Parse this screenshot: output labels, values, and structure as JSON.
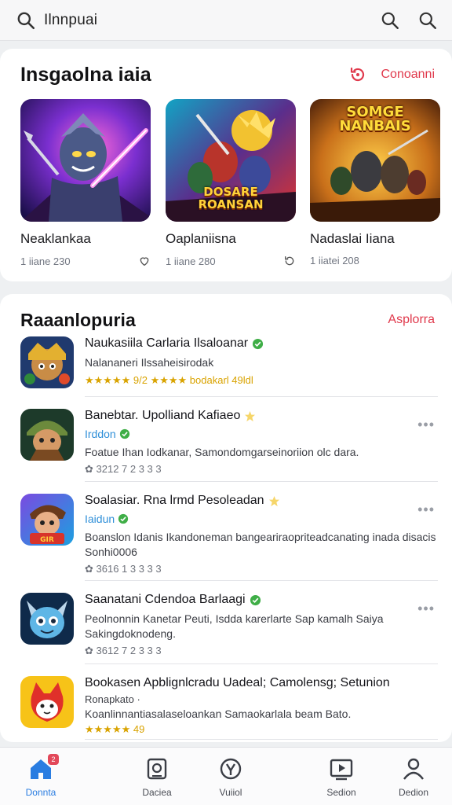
{
  "search": {
    "query": "Ilnnpuai"
  },
  "featured": {
    "title": "Insgaolna iaia",
    "link": "Conoanni",
    "items": [
      {
        "name": "Neaklankaa",
        "meta": "1 iiane 230",
        "icon": "heart-outline-icon"
      },
      {
        "name": "Oaplaniisna",
        "meta": "1 iiane 280",
        "icon": "refresh-icon"
      },
      {
        "name": "Nadaslai Iiana",
        "meta": "1 iiatei 208",
        "icon": ""
      }
    ],
    "art_labels": [
      "",
      "DOSARE ROANSAN",
      "SOMGE NANBAIS"
    ]
  },
  "list": {
    "title": "Raaanlopuria",
    "link": "Asplorra",
    "items": [
      {
        "title": "Naukasiila Carlaria Ilsaloanar",
        "verified": true,
        "developer": "",
        "description": "Nalananeri Ilssaheisirodak",
        "sub": "",
        "rating": "★★★★★ 9/2 ★★★★ bodakarl 49ldl",
        "more": false
      },
      {
        "title": "Banebtar. Upolliand Kafiaeo",
        "verified": false,
        "developer": "Irddon",
        "description": "Foatue Ihan Iodkanar, Samondomgarseinoriion olc dara.",
        "sub": "✿ 3212 7 2 3 3 3",
        "rating": "",
        "more": true
      },
      {
        "title": "Soalasiar. Rna lrmd Pesoleadan",
        "verified": false,
        "developer": "Iaidun",
        "description": "Boanslon Idanis Ikandoneman bangeariraopriteadcanating inada disacis Sonhi0006",
        "sub": "✿ 3616 1 3 3 3 3",
        "rating": "",
        "more": true
      },
      {
        "title": "Saanatani Cdendoa Barlaagi",
        "verified": true,
        "developer": "",
        "description": "Peolnonnin Kanetar Peuti, Isdda karerlarte Sap kamalh Saiya Sakingdoknodeng.",
        "sub": "✿ 3612 7 2 3 3 3",
        "rating": "",
        "more": true
      },
      {
        "title": "Bookasen Apblignlcradu Uadeal; Camolensg; Setunion",
        "verified": false,
        "developer": "",
        "description": "Ronapkato ·",
        "description2": "Koanlinnantiasalaseloankan Samaokarlala beam Bato.",
        "sub": "",
        "rating": "★★★★★ 49",
        "more": false
      }
    ]
  },
  "nav": {
    "items": [
      {
        "label": "Donnta",
        "badge": "2"
      },
      {
        "label": "Daciea"
      },
      {
        "label": "Vuiiol"
      },
      {
        "label": "Sedion"
      },
      {
        "label": "Dedion"
      }
    ]
  },
  "colors": {
    "accent": "#e0394c",
    "link_blue": "#2f8fd8",
    "star": "#f2b400",
    "verified": "#3fae47"
  }
}
